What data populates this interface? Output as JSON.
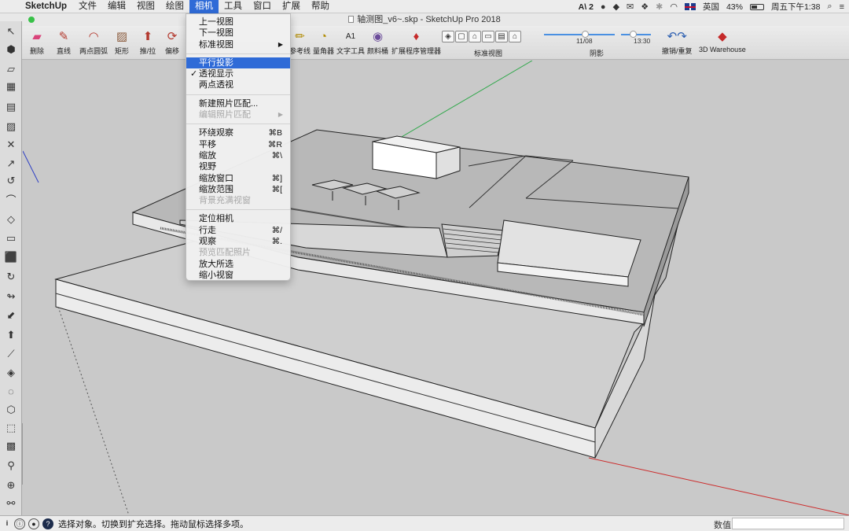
{
  "menubar": {
    "app_name": "SketchUp",
    "items": [
      "文件",
      "编辑",
      "视图",
      "绘图",
      "相机",
      "工具",
      "窗口",
      "扩展",
      "帮助"
    ],
    "active_item": "相机",
    "status": {
      "adobe": "2",
      "input_method": "英国",
      "battery": "43%",
      "clock": "周五下午1:38"
    }
  },
  "window": {
    "title": "轴测图_v6~.skp - SketchUp Pro 2018"
  },
  "toolbar": {
    "tools": [
      {
        "label": "删除",
        "icon": "eraser-icon"
      },
      {
        "label": "直线",
        "icon": "pencil-icon"
      },
      {
        "label": "两点圆弧",
        "icon": "arc-icon"
      },
      {
        "label": "矩形",
        "icon": "rectangle-icon"
      },
      {
        "label": "推/拉",
        "icon": "push-pull-icon"
      },
      {
        "label": "偏移",
        "icon": "offset-icon"
      },
      {
        "label": "参考线",
        "icon": "tape-measure-icon"
      },
      {
        "label": "量角器",
        "icon": "protractor-icon"
      },
      {
        "label": "文字工具",
        "icon": "text-icon"
      },
      {
        "label": "颜料桶",
        "icon": "paint-bucket-icon"
      },
      {
        "label": "扩展程序管理器",
        "icon": "extension-manager-icon"
      },
      {
        "label": "标准视图",
        "icon": "standard-views-icon"
      },
      {
        "label": "阴影",
        "icon": "shadows-icon"
      },
      {
        "label": "撤销/重复",
        "icon": "undo-redo-icon"
      },
      {
        "label": "3D Warehouse",
        "icon": "warehouse-icon"
      }
    ],
    "shadow_date": "11/08",
    "shadow_time": "13:30"
  },
  "camera_menu": {
    "items": [
      {
        "label": "上一视图",
        "shortcut": "",
        "enabled": true
      },
      {
        "label": "下一视图",
        "shortcut": "",
        "enabled": true
      },
      {
        "label": "标准视图",
        "shortcut": "",
        "enabled": true,
        "submenu": true
      },
      {
        "separator": true
      },
      {
        "label": "平行投影",
        "shortcut": "",
        "enabled": true,
        "highlighted": true
      },
      {
        "label": "透视显示",
        "shortcut": "",
        "enabled": true,
        "checked": true
      },
      {
        "label": "两点透视",
        "shortcut": "",
        "enabled": true
      },
      {
        "separator": true
      },
      {
        "label": "新建照片匹配...",
        "shortcut": "",
        "enabled": true
      },
      {
        "label": "编辑照片匹配",
        "shortcut": "",
        "enabled": false,
        "submenu": true
      },
      {
        "separator": true
      },
      {
        "label": "环绕观察",
        "shortcut": "⌘B",
        "enabled": true
      },
      {
        "label": "平移",
        "shortcut": "⌘R",
        "enabled": true
      },
      {
        "label": "缩放",
        "shortcut": "⌘\\",
        "enabled": true
      },
      {
        "label": "视野",
        "shortcut": "",
        "enabled": true
      },
      {
        "label": "缩放窗口",
        "shortcut": "⌘]",
        "enabled": true
      },
      {
        "label": "缩放范围",
        "shortcut": "⌘[",
        "enabled": true
      },
      {
        "label": "背景充满视窗",
        "shortcut": "",
        "enabled": false
      },
      {
        "separator": true
      },
      {
        "label": "定位相机",
        "shortcut": "",
        "enabled": true
      },
      {
        "label": "行走",
        "shortcut": "⌘/",
        "enabled": true
      },
      {
        "label": "观察",
        "shortcut": "⌘.",
        "enabled": true
      },
      {
        "label": "预览匹配照片",
        "shortcut": "",
        "enabled": false
      },
      {
        "label": "放大所选",
        "shortcut": "",
        "enabled": true
      },
      {
        "label": "缩小视窗",
        "shortcut": "",
        "enabled": true
      }
    ]
  },
  "statusbar": {
    "message": "选择对象。切换到扩充选择。拖动鼠标选择多项。",
    "measurement_label": "数值",
    "measurement_value": ""
  },
  "colors": {
    "menu_highlight": "#2f6bd7",
    "viewport_bg": "#c9c9c9",
    "axis_red": "#cc2b2b",
    "axis_green": "#2fa84a",
    "axis_blue": "#2d3fc4"
  }
}
